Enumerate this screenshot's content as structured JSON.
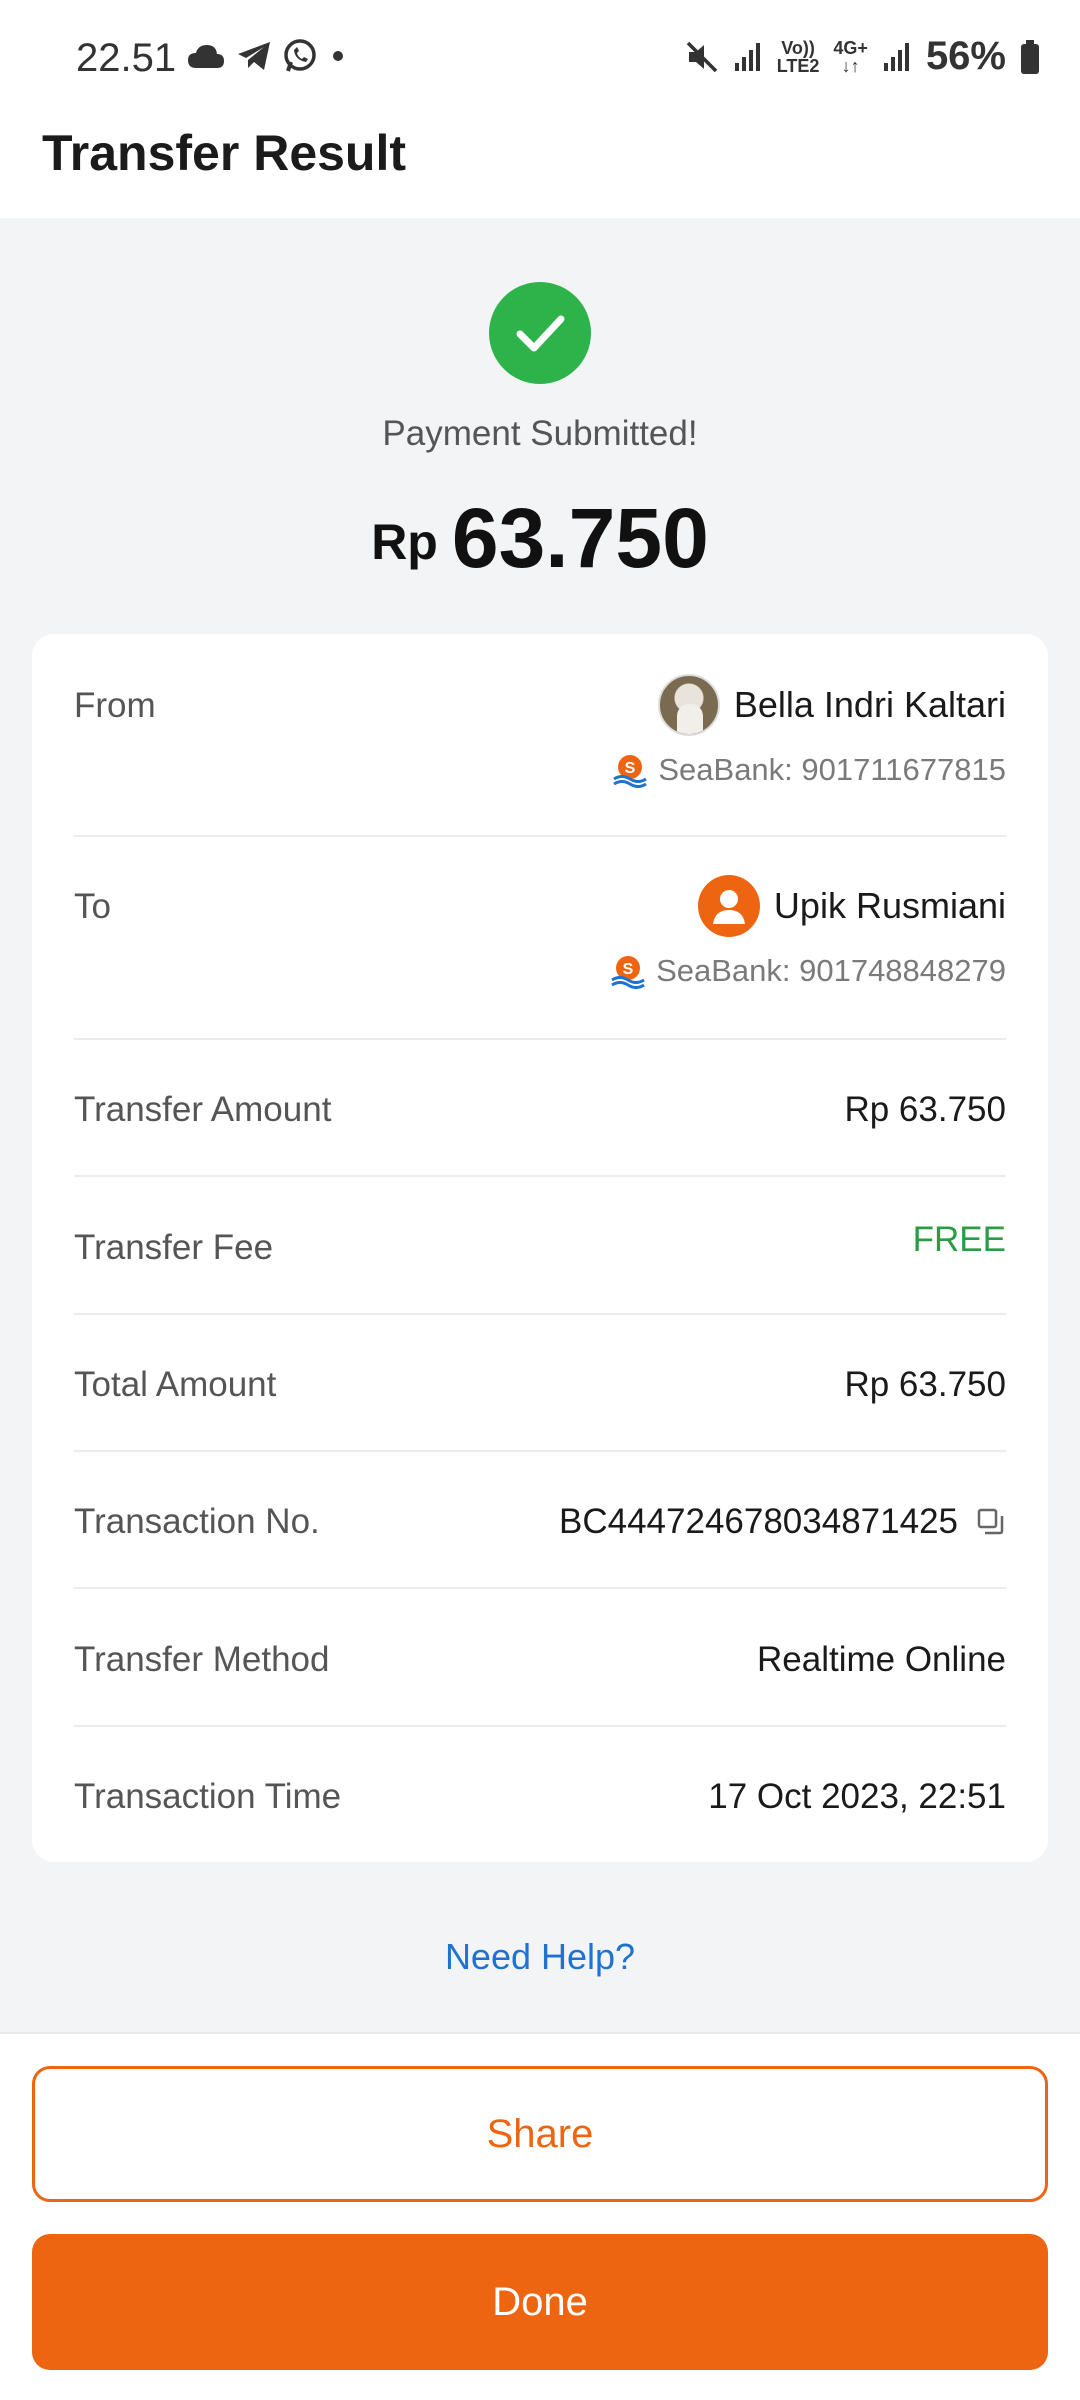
{
  "status_bar": {
    "time": "22.51",
    "battery": "56%",
    "volte_label": "Vo))",
    "lte_label": "LTE2",
    "network_label": "4G+",
    "icons": [
      "cloud-icon",
      "telegram-icon",
      "whatsapp-icon",
      "dot-icon",
      "mute-icon",
      "signal-icon",
      "signal-icon",
      "battery-icon"
    ]
  },
  "header": {
    "title": "Transfer Result"
  },
  "result": {
    "status_text": "Payment Submitted!",
    "currency": "Rp",
    "amount": "63.750",
    "icon": "check-circle-icon",
    "color": "#2db34a"
  },
  "from": {
    "label": "From",
    "name": "Bella Indri Kaltari",
    "account": "SeaBank: 901711677815"
  },
  "to": {
    "label": "To",
    "name": "Upik Rusmiani",
    "account": "SeaBank: 901748848279"
  },
  "details": {
    "transfer_amount": {
      "label": "Transfer Amount",
      "value": "Rp 63.750"
    },
    "transfer_fee": {
      "label": "Transfer Fee",
      "value": "FREE"
    },
    "total_amount": {
      "label": "Total Amount",
      "value": "Rp 63.750"
    },
    "transaction_no": {
      "label": "Transaction No.",
      "value": "BC444724678034871425"
    },
    "transfer_method": {
      "label": "Transfer Method",
      "value": "Realtime Online"
    },
    "transaction_time": {
      "label": "Transaction Time",
      "value": "17 Oct 2023, 22:51"
    }
  },
  "help": {
    "label": "Need Help?"
  },
  "actions": {
    "share_label": "Share",
    "done_label": "Done"
  },
  "colors": {
    "accent": "#ee6511",
    "success": "#2db34a",
    "link": "#1f73d0",
    "free": "#2a9d44"
  }
}
